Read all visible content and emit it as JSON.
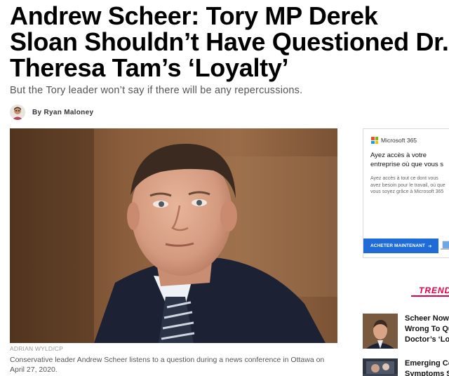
{
  "article": {
    "headline": "Andrew Scheer: Tory MP Derek Sloan Shouldn’t Have Questioned Dr. Theresa Tam’s ‘Loyalty’",
    "dek": "But the Tory leader won’t say if there will be any repercussions.",
    "byline": "By Ryan Maloney",
    "photo_credit": "ADRIAN WYLD/CP",
    "caption": "Conservative leader Andrew Scheer listens to a question during a news conference in Ottawa on April 27, 2020."
  },
  "ad": {
    "brand": "Microsoft 365",
    "title_line1": "Ayez accès à votre",
    "title_line2": "entreprise où que vous s",
    "body": "Ayez accès à tout ce dont vous avez besoin pour le travail, où que vous soyez grâce à Microsoft 365",
    "cta": "ACHETER MAINTENANT",
    "cta_icon": "arrow-right-icon",
    "logo_colors": [
      "#f25022",
      "#7fba00",
      "#00a4ef",
      "#ffb900"
    ]
  },
  "trending": {
    "label": "TREND",
    "accent": "#e40046",
    "items": [
      {
        "line1": "Scheer Now",
        "line2": "Wrong To Qu",
        "line3": "Doctor’s ‘Loy"
      },
      {
        "line1": "Emerging Co",
        "line2": "Symptoms S"
      }
    ]
  }
}
